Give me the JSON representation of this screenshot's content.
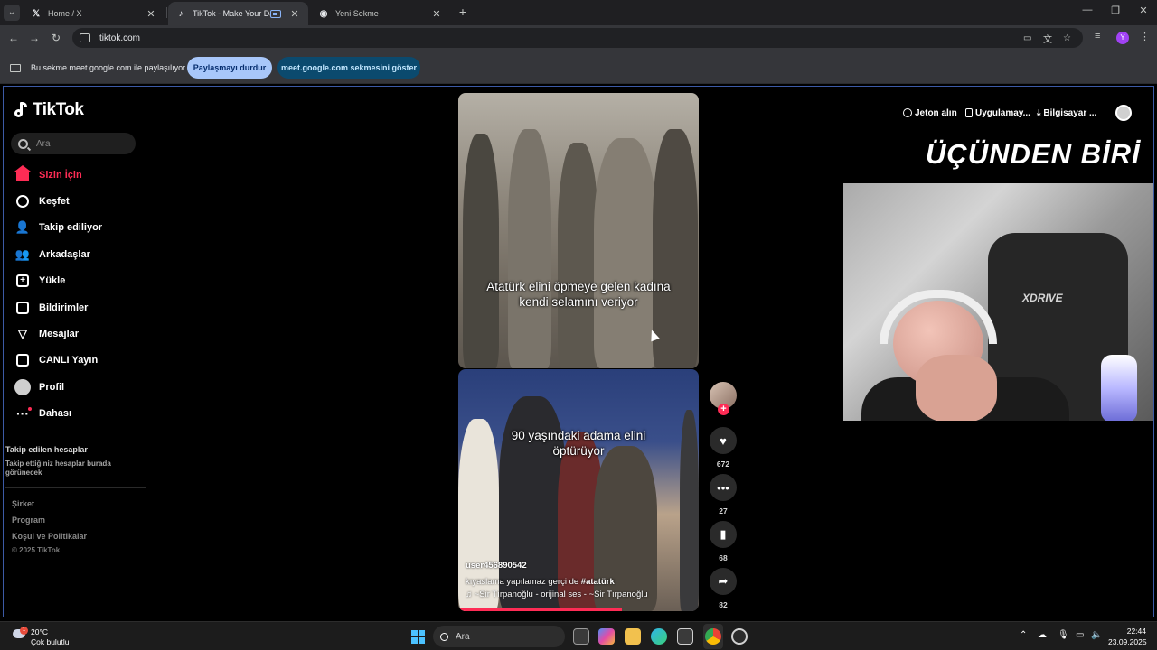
{
  "browser": {
    "tabs": [
      {
        "label": "Home / X",
        "icon": "x-logo-icon"
      },
      {
        "label": "TikTok - Make Your Day",
        "icon": "tiktok-icon",
        "active": true
      },
      {
        "label": "Yeni Sekme",
        "icon": "chrome-icon"
      }
    ],
    "url": "tiktok.com",
    "profile_initial": "Y"
  },
  "sharebar": {
    "message": "Bu sekme meet.google.com ile paylaşılıyor",
    "stop_label": "Paylaşmayı durdur",
    "show_label": "meet.google.com sekmesini göster"
  },
  "tiktok": {
    "logo": "TikTok",
    "search_placeholder": "Ara",
    "nav": [
      {
        "label": "Sizin İçin",
        "icon": "home-icon",
        "active": true
      },
      {
        "label": "Keşfet",
        "icon": "compass-icon"
      },
      {
        "label": "Takip ediliyor",
        "icon": "follow-user-icon"
      },
      {
        "label": "Arkadaşlar",
        "icon": "friends-icon"
      },
      {
        "label": "Yükle",
        "icon": "upload-icon"
      },
      {
        "label": "Bildirimler",
        "icon": "notification-icon"
      },
      {
        "label": "Mesajlar",
        "icon": "message-icon"
      },
      {
        "label": "CANLI Yayın",
        "icon": "live-icon"
      },
      {
        "label": "Profil",
        "icon": "profile-avatar-icon"
      },
      {
        "label": "Dahası",
        "icon": "more-icon"
      }
    ],
    "following_heading": "Takip edilen hesaplar",
    "following_sub": "Takip ettiğiniz hesaplar burada görünecek",
    "footer": [
      "Şirket",
      "Program",
      "Koşul ve Politikalar"
    ],
    "copyright": "© 2025 TikTok",
    "top_actions": {
      "coins": "Jeton alın",
      "app": "Uygulamay...",
      "desktop": "Bilgisayar ..."
    },
    "video1": {
      "caption": "Atatürk elini öpmeye gelen kadına kendi selamını veriyor"
    },
    "video2": {
      "caption": "90 yaşındaki adama elini öptürüyor",
      "username": "user456890542",
      "description": "kıyaslama yapılamaz gerçi de",
      "hashtag": "#atatürk",
      "music": "♫ ~Sir Tırpanoğlu - orijinal ses - ~Sir Tırpanoğlu",
      "progress": 0.68
    },
    "rail": {
      "likes": "672",
      "comments": "27",
      "saves": "68",
      "shares": "82"
    },
    "accent": "#fe2c55"
  },
  "overlay": {
    "title": "ÜÇÜNDEN BİRİ",
    "chair_brand": "XDRIVE"
  },
  "taskbar": {
    "temperature": "20°C",
    "weather": "Çok bulutlu",
    "weather_badge": "1",
    "search_placeholder": "Ara",
    "time": "22:44",
    "date": "23.09.2025"
  }
}
